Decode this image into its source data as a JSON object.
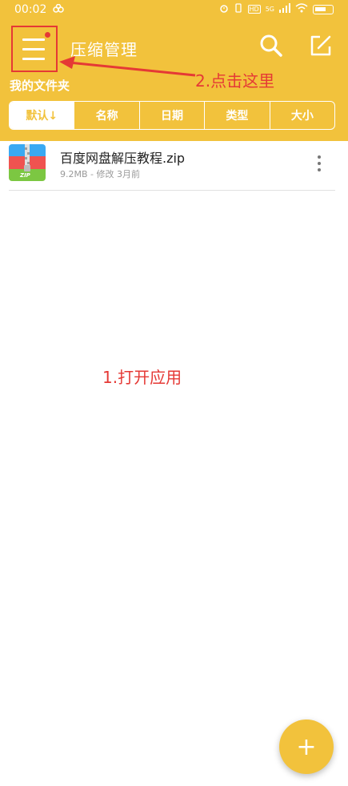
{
  "status_bar": {
    "time": "00:02",
    "hd_badge": "HD",
    "network": "5G"
  },
  "toolbar": {
    "title": "压缩管理",
    "menu_icon": "hamburger-icon",
    "search_icon": "search-icon",
    "edit_icon": "edit-icon"
  },
  "folder": {
    "title": "我的文件夹"
  },
  "sort_tabs": [
    {
      "label": "默认↓"
    },
    {
      "label": "名称"
    },
    {
      "label": "日期"
    },
    {
      "label": "类型"
    },
    {
      "label": "大小"
    }
  ],
  "files": [
    {
      "name": "百度网盘解压教程.zip",
      "meta": "9.2MB - 修改 3月前",
      "icon_label": "ZIP"
    }
  ],
  "annotations": {
    "step1": "1.打开应用",
    "step2": "2.点击这里"
  },
  "fab": {
    "label": "+"
  },
  "colors": {
    "accent": "#f2c23c",
    "annotation": "#e53935"
  }
}
